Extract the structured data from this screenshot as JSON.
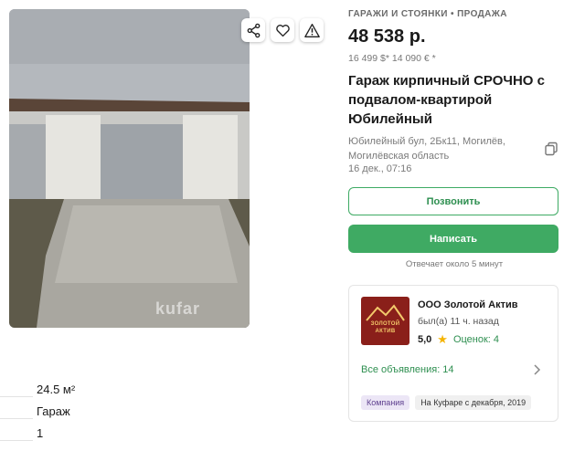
{
  "listing": {
    "breadcrumb": "ГАРАЖИ И СТОЯНКИ • ПРОДАЖА",
    "price": "48 538 р.",
    "sub_price": "16 499 $*  14 090 € *",
    "title": "Гараж кирпичный СРОЧНО с подвалом-квартирой Юбилейный",
    "address": "Юбилейный бул, 2Бк11, Могилёв, Могилёвская область",
    "date": "16 дек., 07:16"
  },
  "photo": {
    "watermark": "kufar",
    "icons": [
      "share-icon",
      "heart-icon",
      "warning-icon"
    ]
  },
  "actions": {
    "call_label": "Позвонить",
    "write_label": "Написать",
    "reply_note": "Отвечает около 5 минут"
  },
  "seller": {
    "logo_line1": "ЗОЛОТОЙ",
    "logo_line2": "АКТИВ",
    "name": "ООО Золотой Актив",
    "last_seen": "был(а) 11 ч. назад",
    "rating": "5,0",
    "reviews": "Оценок: 4",
    "all_ads": "Все объявления: 14",
    "tag_company": "Компания",
    "tag_since": "На Куфаре с декабря, 2019"
  },
  "params": [
    {
      "value": "24.5 м²"
    },
    {
      "value": "Гараж"
    },
    {
      "value": "1"
    }
  ],
  "colors": {
    "accent_green": "#3faa63",
    "logo_bg": "#8a1f1a"
  }
}
